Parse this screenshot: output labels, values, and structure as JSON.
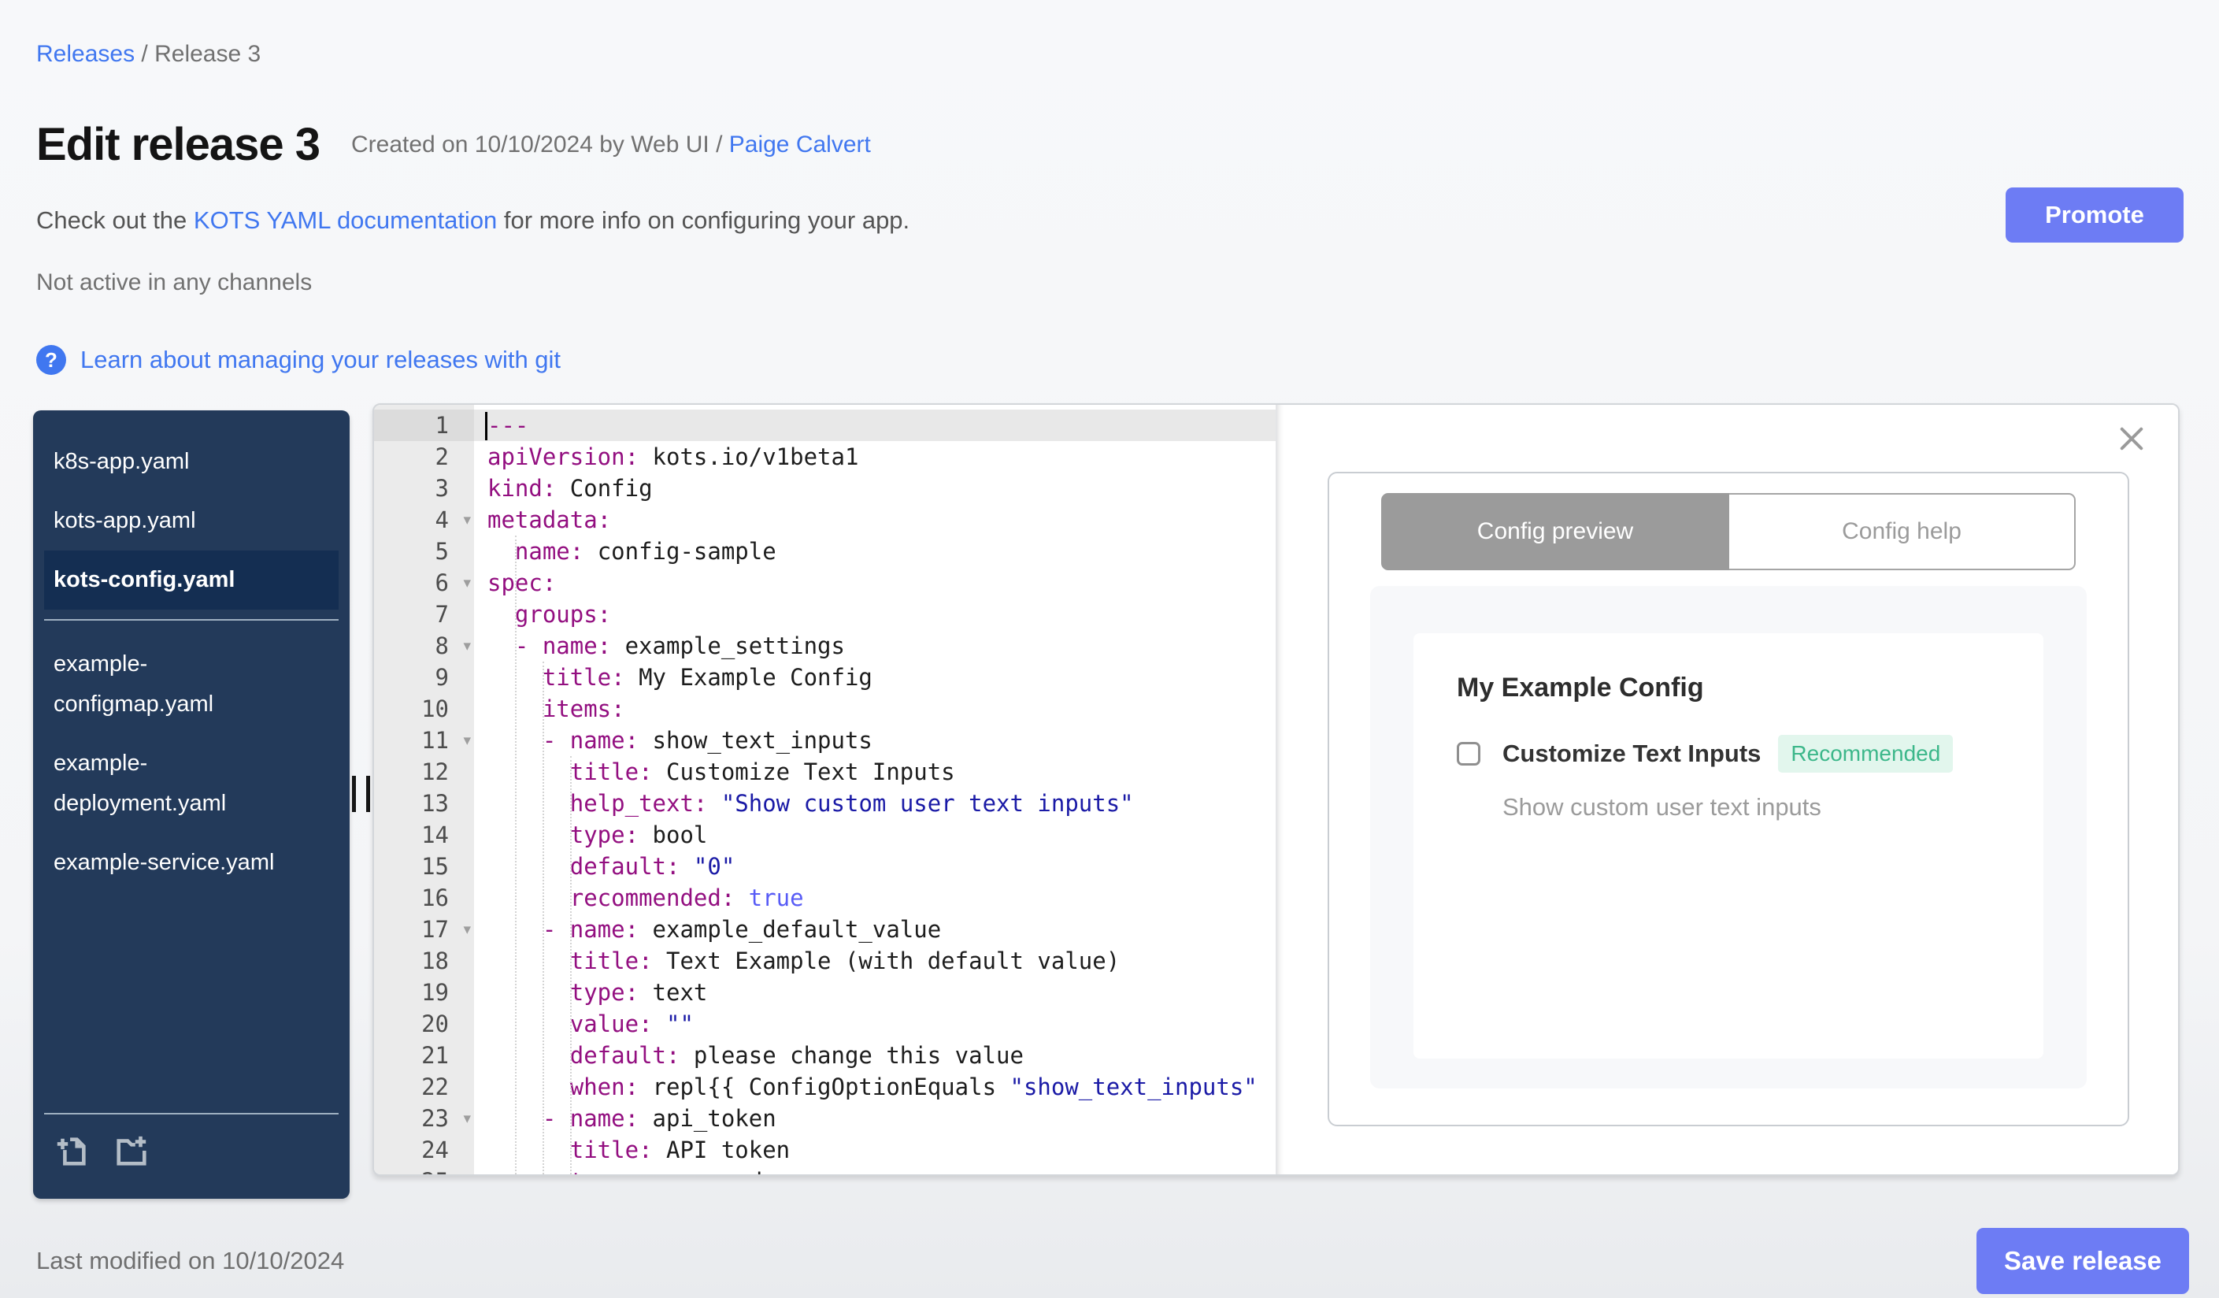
{
  "breadcrumb": {
    "link": "Releases",
    "separator": " / ",
    "current": "Release 3"
  },
  "header": {
    "title": "Edit release 3",
    "created_prefix": "Created on 10/10/2024 by Web UI / ",
    "created_author": "Paige Calvert",
    "doc_text_before": "Check out the ",
    "doc_link": "KOTS YAML documentation",
    "doc_text_after": " for more info on configuring your app.",
    "promote_label": "Promote",
    "channel_status": "Not active in any channels",
    "help_glyph": "?",
    "git_link": "Learn about managing your releases with git"
  },
  "sidebar": {
    "files_primary": [
      "k8s-app.yaml",
      "kots-app.yaml",
      "kots-config.yaml"
    ],
    "selected_file": "kots-config.yaml",
    "files_secondary": [
      "example-configmap.yaml",
      "example-deployment.yaml",
      "example-service.yaml"
    ],
    "icons": [
      "new-file-icon",
      "new-folder-icon"
    ]
  },
  "editor": {
    "active_line": 1,
    "fold_lines": [
      4,
      6,
      8,
      11,
      17,
      23
    ],
    "fold_glyph": "▾",
    "lines": [
      [
        [
          "k",
          "---"
        ]
      ],
      [
        [
          "k",
          "apiVersion:"
        ],
        [
          "p",
          " kots.io/v1beta1"
        ]
      ],
      [
        [
          "k",
          "kind:"
        ],
        [
          "p",
          " Config"
        ]
      ],
      [
        [
          "k",
          "metadata:"
        ]
      ],
      [
        [
          "p",
          "  "
        ],
        [
          "k",
          "name:"
        ],
        [
          "p",
          " config-sample"
        ]
      ],
      [
        [
          "k",
          "spec:"
        ]
      ],
      [
        [
          "p",
          "  "
        ],
        [
          "k",
          "groups:"
        ]
      ],
      [
        [
          "p",
          "  "
        ],
        [
          "k",
          "- name:"
        ],
        [
          "p",
          " example_settings"
        ]
      ],
      [
        [
          "p",
          "    "
        ],
        [
          "k",
          "title:"
        ],
        [
          "p",
          " My Example Config"
        ]
      ],
      [
        [
          "p",
          "    "
        ],
        [
          "k",
          "items:"
        ]
      ],
      [
        [
          "p",
          "    "
        ],
        [
          "k",
          "- name:"
        ],
        [
          "p",
          " show_text_inputs"
        ]
      ],
      [
        [
          "p",
          "      "
        ],
        [
          "k",
          "title:"
        ],
        [
          "p",
          " Customize Text Inputs"
        ]
      ],
      [
        [
          "p",
          "      "
        ],
        [
          "k",
          "help_text:"
        ],
        [
          "p",
          " "
        ],
        [
          "s",
          "\"Show custom user text inputs\""
        ]
      ],
      [
        [
          "p",
          "      "
        ],
        [
          "k",
          "type:"
        ],
        [
          "p",
          " bool"
        ]
      ],
      [
        [
          "p",
          "      "
        ],
        [
          "k",
          "default:"
        ],
        [
          "p",
          " "
        ],
        [
          "s",
          "\"0\""
        ]
      ],
      [
        [
          "p",
          "      "
        ],
        [
          "k",
          "recommended:"
        ],
        [
          "p",
          " "
        ],
        [
          "b",
          "true"
        ]
      ],
      [
        [
          "p",
          "    "
        ],
        [
          "k",
          "- name:"
        ],
        [
          "p",
          " example_default_value"
        ]
      ],
      [
        [
          "p",
          "      "
        ],
        [
          "k",
          "title:"
        ],
        [
          "p",
          " Text Example (with default value)"
        ]
      ],
      [
        [
          "p",
          "      "
        ],
        [
          "k",
          "type:"
        ],
        [
          "p",
          " text"
        ]
      ],
      [
        [
          "p",
          "      "
        ],
        [
          "k",
          "value:"
        ],
        [
          "p",
          " "
        ],
        [
          "s",
          "\"\""
        ]
      ],
      [
        [
          "p",
          "      "
        ],
        [
          "k",
          "default:"
        ],
        [
          "p",
          " please change this value"
        ]
      ],
      [
        [
          "p",
          "      "
        ],
        [
          "k",
          "when:"
        ],
        [
          "p",
          " repl{{ ConfigOptionEquals "
        ],
        [
          "s",
          "\"show_text_inputs\""
        ]
      ],
      [
        [
          "p",
          "    "
        ],
        [
          "k",
          "- name:"
        ],
        [
          "p",
          " api_token"
        ]
      ],
      [
        [
          "p",
          "      "
        ],
        [
          "k",
          "title:"
        ],
        [
          "p",
          " API token"
        ]
      ],
      [
        [
          "p",
          "      "
        ],
        [
          "k",
          "type:"
        ],
        [
          "p",
          " password"
        ]
      ]
    ]
  },
  "preview": {
    "tabs": [
      "Config preview",
      "Config help"
    ],
    "active_tab": "Config preview",
    "group_title": "My Example Config",
    "item_label": "Customize Text Inputs",
    "item_badge": "Recommended",
    "item_help": "Show custom user text inputs",
    "checkbox_checked": false
  },
  "footer": {
    "last_modified": "Last modified on 10/10/2024",
    "save_label": "Save release"
  },
  "colors": {
    "accent_button": "#6d7cf4",
    "link_blue": "#4077f0",
    "sidebar_bg": "#233a5a",
    "sidebar_selected_bg": "#142e52",
    "code_key": "#930f80",
    "code_string": "#1a1aa6",
    "code_boolean": "#585cf6",
    "badge_green": "#3cb78a",
    "badge_green_bg": "#e2f6ed",
    "tab_active_bg": "#9b9b9b"
  }
}
